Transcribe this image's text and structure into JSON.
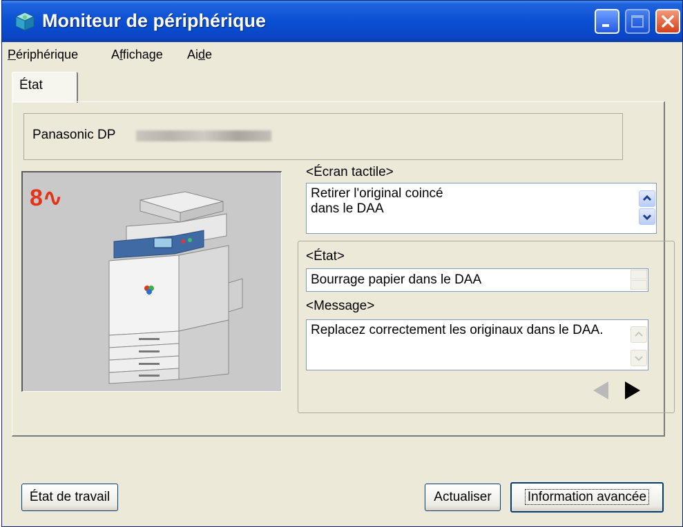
{
  "window": {
    "title": "Moniteur de périphérique",
    "icon": "monitor-cube-icon",
    "controls": [
      "minimize-icon",
      "maximize-icon",
      "close-icon"
    ]
  },
  "menu": {
    "items": [
      {
        "label": "Périphérique",
        "accelerator": "P"
      },
      {
        "label": "Affichage",
        "accelerator": "f"
      },
      {
        "label": "Aide",
        "accelerator": "d"
      }
    ]
  },
  "tabs": [
    {
      "label": "État"
    }
  ],
  "device": {
    "name": "Panasonic DP"
  },
  "image": {
    "logo": "8∿",
    "logo_color": "#e2331b"
  },
  "touch_screen": {
    "label": "<Écran tactile>",
    "text_line1": "Retirer l'original coincé",
    "text_line2": "dans le DAA"
  },
  "status": {
    "label": "<État>",
    "value": "Bourrage papier dans le DAA"
  },
  "message": {
    "label": "<Message>",
    "text": "Replacez correctement les originaux dans le DAA."
  },
  "buttons": {
    "job_status": "État de travail",
    "refresh": "Actualiser",
    "advanced": "Information avancée"
  },
  "colors": {
    "titlebar": "#0b4fd3",
    "window_bg": "#ece9d8",
    "printer_bg": "#c9c9c9"
  }
}
